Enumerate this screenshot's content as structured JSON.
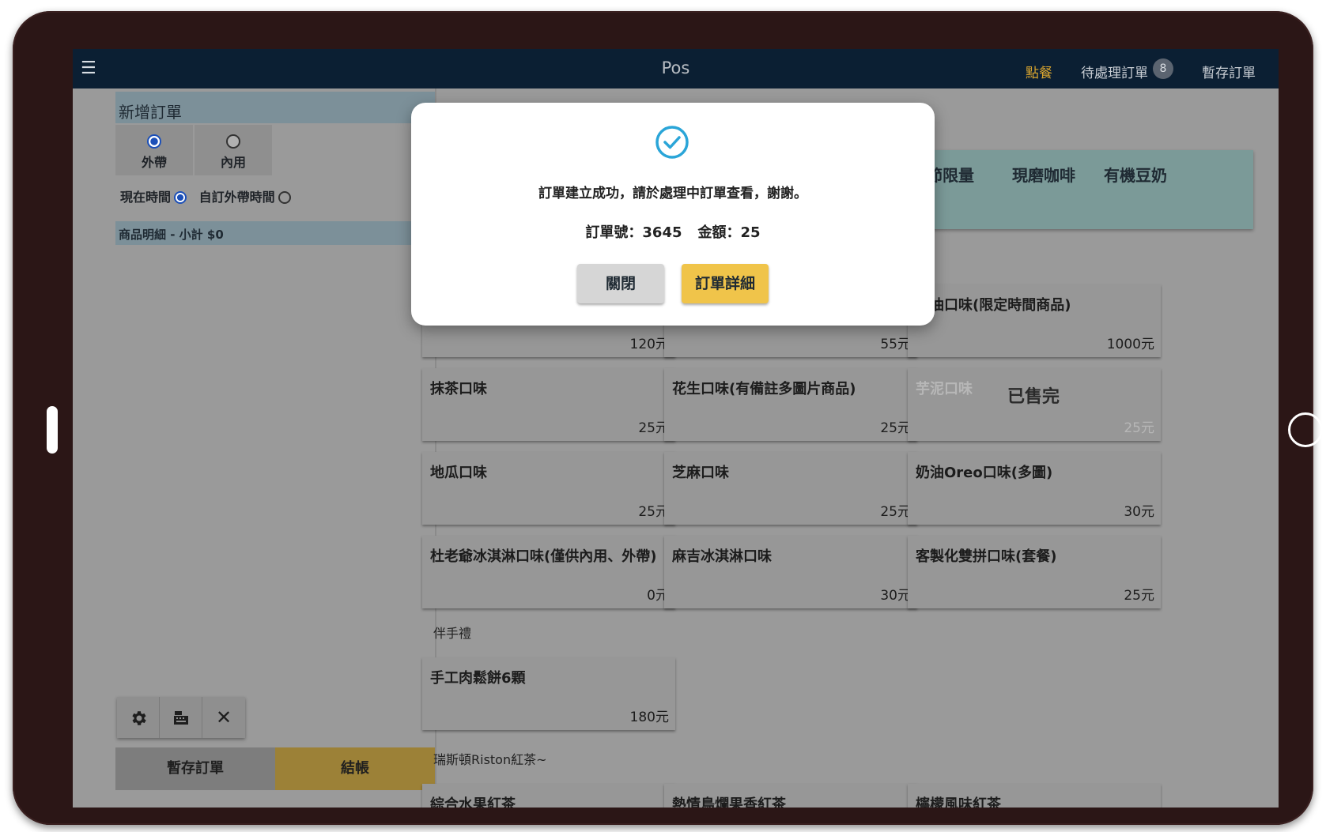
{
  "topbar": {
    "menu_icon": "☰",
    "title": "Pos",
    "nav_order": "點餐",
    "nav_pending": "待處理訂單",
    "pending_count": "8",
    "nav_draft": "暫存訂單"
  },
  "left": {
    "header": "新增訂單",
    "option_takeout": "外帶",
    "option_dinein": "內用",
    "time_now": "現在時間",
    "time_custom": "自訂外帶時間",
    "items_header": "商品明細 - 小計 $0",
    "draft_button": "暫存訂單",
    "checkout_button": "結帳"
  },
  "categories": {
    "seasonal": "節限量",
    "coffee": "現磨咖啡",
    "soy": "有機豆奶"
  },
  "products": [
    {
      "name": "",
      "price": "120元"
    },
    {
      "name": "",
      "price": "55元"
    },
    {
      "name": "奶油口味(限定時間商品)",
      "price": "1000元"
    },
    {
      "name": "抹茶口味",
      "price": "25元"
    },
    {
      "name": "花生口味(有備註多圖片商品)",
      "price": "25元"
    },
    {
      "name": "芋泥口味",
      "price": "25元",
      "soldout": "已售完"
    },
    {
      "name": "地瓜口味",
      "price": "25元"
    },
    {
      "name": "芝麻口味",
      "price": "25元"
    },
    {
      "name": "奶油Oreo口味(多圖)",
      "price": "30元"
    },
    {
      "name": "杜老爺冰淇淋口味(僅供內用、外帶)",
      "price": "0元"
    },
    {
      "name": "麻吉冰淇淋口味",
      "price": "30元"
    },
    {
      "name": "客製化雙拼口味(套餐)",
      "price": "25元"
    },
    {
      "name": "手工肉鬆餅6顆",
      "price": "180元"
    },
    {
      "name": "綜合水果紅茶",
      "price": ""
    },
    {
      "name": "熱情鳥爛果香紅茶",
      "price": ""
    },
    {
      "name": "檸檬風味紅茶",
      "price": ""
    }
  ],
  "sections": {
    "gift": "伴手禮",
    "tea": "瑞斯頓Riston紅茶~"
  },
  "modal": {
    "message": "訂單建立成功，請於處理中訂單查看，謝謝。",
    "order_label": "訂單號：3645",
    "amount_label": "金額：25",
    "close_button": "關閉",
    "detail_button": "訂單詳細"
  },
  "colors": {
    "topbar": "#0b1f33",
    "accent": "#d9a52f",
    "checkout": "#9c8137",
    "check_icon": "#2aa5d8"
  },
  "icons": {
    "menu": "hamburger-icon",
    "settings": "gear-icon",
    "register": "cash-register-icon",
    "close": "close-icon",
    "success": "check-circle-icon"
  }
}
